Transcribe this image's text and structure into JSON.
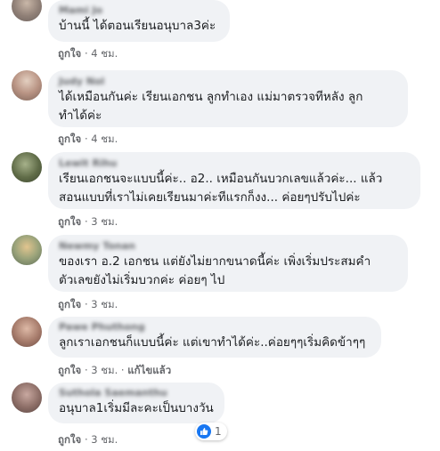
{
  "colors": {
    "bubble": "#f0f2f5",
    "meta_text": "#65676b",
    "like_blue": "#1877f2"
  },
  "comments": [
    {
      "author": "Mami Jo",
      "text": "บ้านนี้ ได้ตอนเรียนอนุบาล3ค่ะ",
      "like_label": "ถูกใจ",
      "time": "4 ชม."
    },
    {
      "author": "Judy Nol",
      "text": "ได้เหมือนกันค่ะ เรียนเอกชน ลูกทำเอง แม่มาตรวจทีหลัง ลูก\nทำได้ค่ะ",
      "like_label": "ถูกใจ",
      "time": "4 ชม."
    },
    {
      "author": "Lewit Rihu",
      "text": "เรียนเอกชนจะแบบนี้ค่ะ.. อ2.. เหมือนกันบวกเลขแล้วค่ะ... แล้ว\nสอนแบบที่เราไม่เคยเรียนมาค่ะทีแรกก็งง... ค่อยๆปรับไปค่ะ",
      "like_label": "ถูกใจ",
      "time": "3 ชม."
    },
    {
      "author": "Newmy Tonan",
      "text": "ของเรา อ.2 เอกชน แต่ยังไม่ยากขนาดนี้ค่ะ เพิ่งเริ่มประสมคำ\nตัวเลขยังไม่เริ่มบวกค่ะ ค่อยๆ ไป",
      "like_label": "ถูกใจ",
      "time": "3 ชม."
    },
    {
      "author": "Pawe Phuthong",
      "text": "ลูกเราเอกชนก็แบบนี้ค่ะ แต่เขาทำได้ค่ะ..ค่อยๆๆเริ่มคิดข้าๆๆ",
      "like_label": "ถูกใจ",
      "time": "3 ชม.",
      "edit_label": "แก้ไขแล้ว"
    },
    {
      "author": "Suthola Saemanthu",
      "text": "อนุบาล1เริ่มมีละคะเป็นบางวัน",
      "like_label": "ถูกใจ",
      "time": "3 ชม.",
      "reaction_count": "1"
    }
  ]
}
